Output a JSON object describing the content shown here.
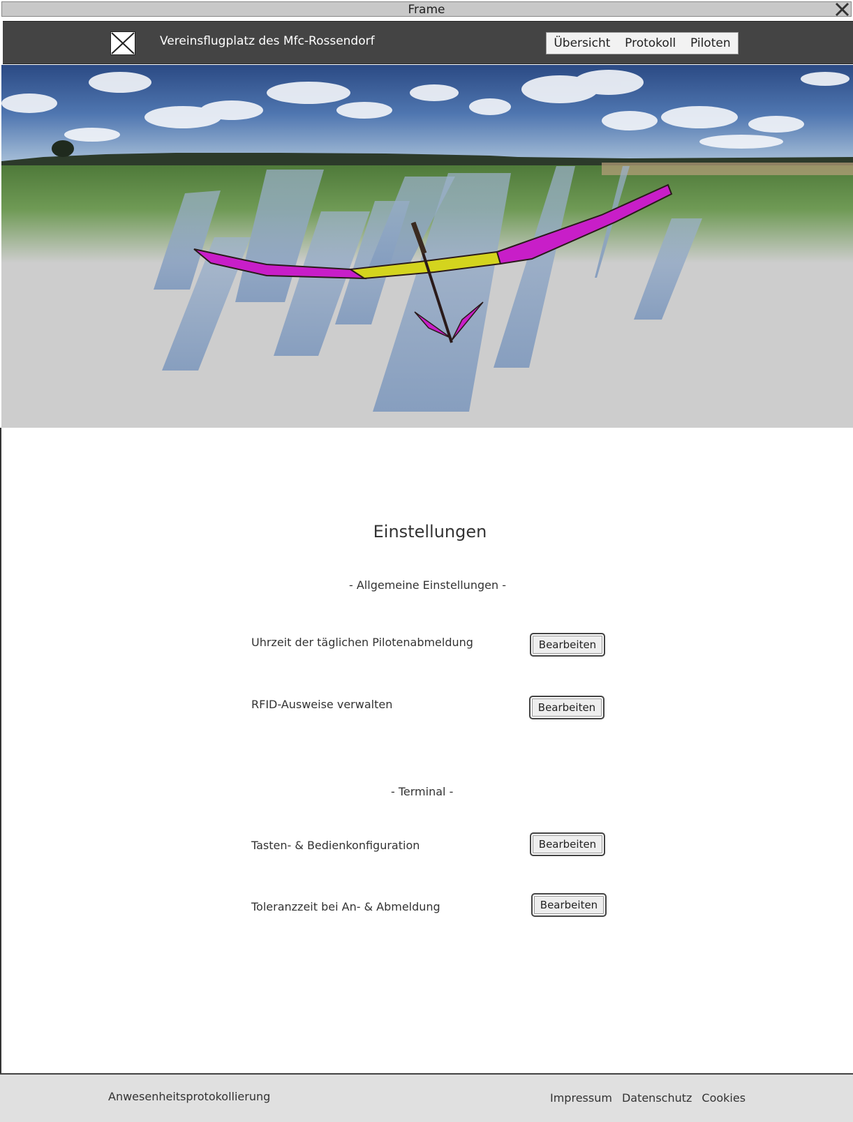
{
  "window": {
    "title": "Frame"
  },
  "header": {
    "site_title": "Vereinsflugplatz des Mfc-Rossendorf",
    "nav": [
      {
        "label": "Übersicht"
      },
      {
        "label": "Protokoll"
      },
      {
        "label": "Piloten"
      }
    ]
  },
  "main": {
    "heading": "Einstellungen",
    "sections": [
      {
        "label": "- Allgemeine Einstellungen -",
        "rows": [
          {
            "label": "Uhrzeit der täglichen Pilotenabmeldung",
            "button": "Bearbeiten"
          },
          {
            "label": "RFID-Ausweise verwalten",
            "button": "Bearbeiten"
          }
        ]
      },
      {
        "label": "- Terminal -",
        "rows": [
          {
            "label": "Tasten- & Bedienkonfiguration",
            "button": "Bearbeiten"
          },
          {
            "label": "Toleranzzeit bei An- & Abmeldung",
            "button": "Bearbeiten"
          }
        ]
      }
    ]
  },
  "footer": {
    "brand": "Anwesenheitsprotokollierung",
    "links": [
      {
        "label": "Impressum"
      },
      {
        "label": "Datenschutz"
      },
      {
        "label": "Cookies"
      }
    ]
  },
  "colors": {
    "header_bg": "#444444",
    "hero_bg": "#cdcdcd",
    "wing_magenta": "#c81ec8",
    "wing_yellow": "#d4d41e",
    "footer_bg": "#e0e0e0"
  },
  "icons": [
    "close-icon",
    "logo-placeholder-icon"
  ]
}
